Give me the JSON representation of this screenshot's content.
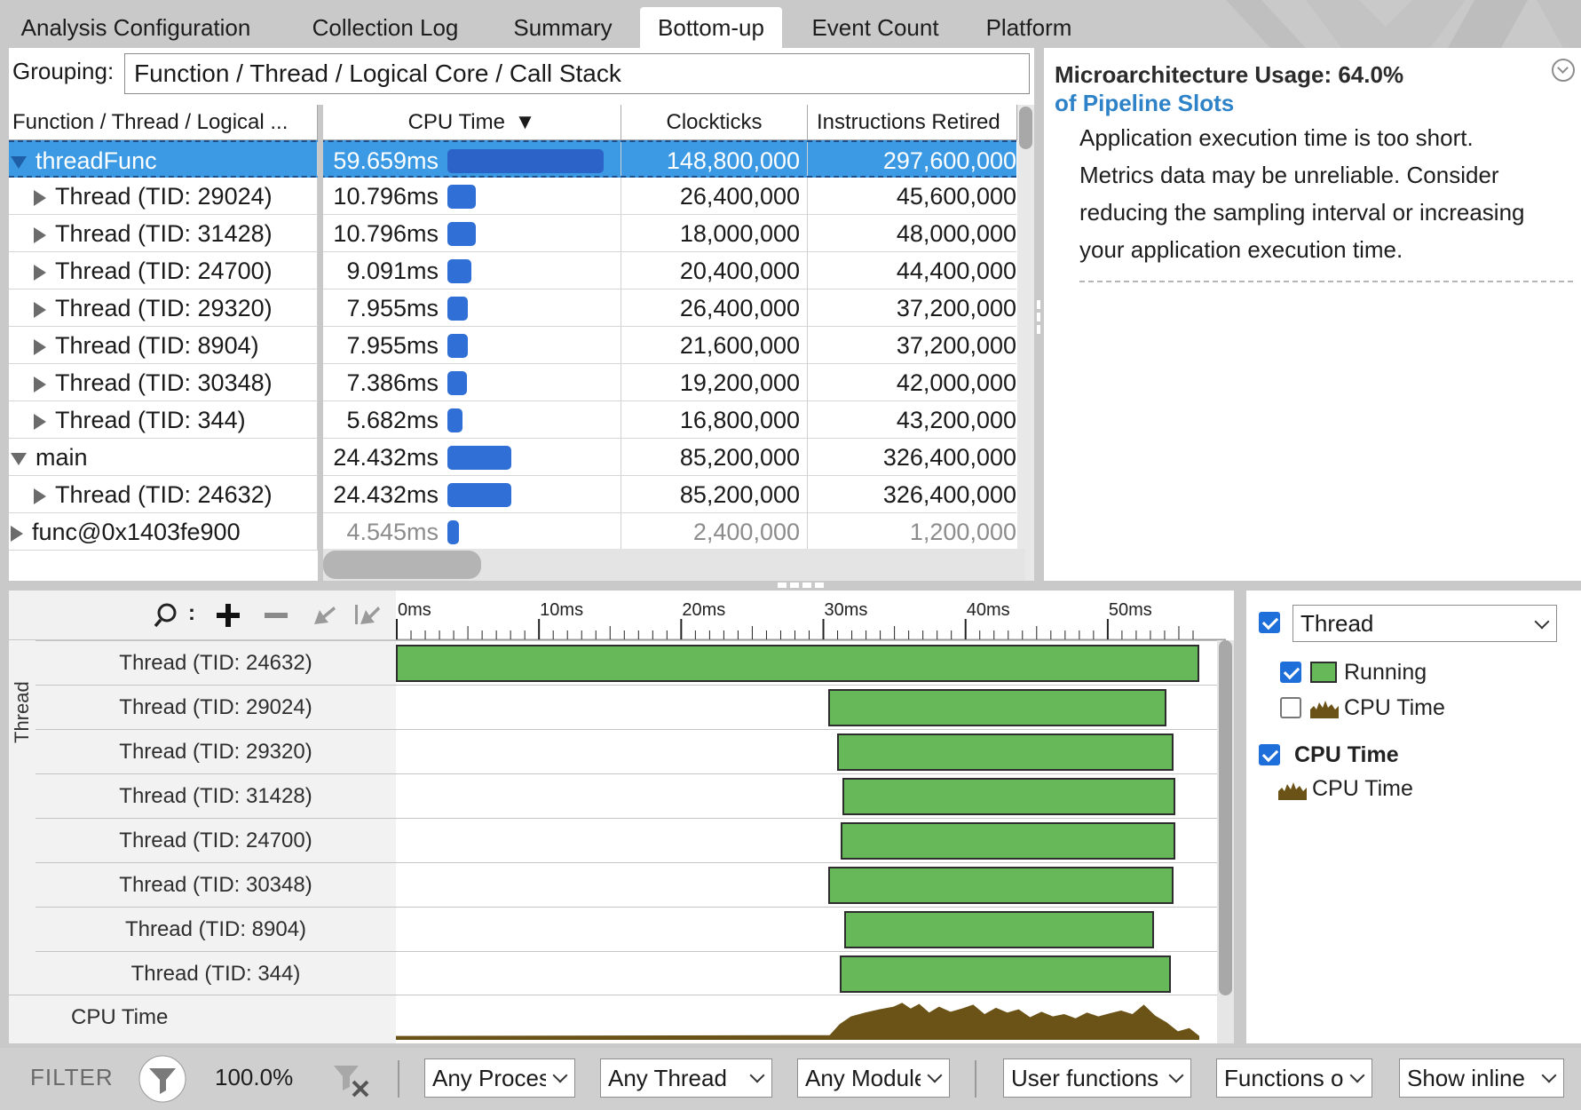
{
  "tabs": [
    {
      "label": "Analysis Configuration",
      "active": false
    },
    {
      "label": "Collection Log",
      "active": false
    },
    {
      "label": "Summary",
      "active": false
    },
    {
      "label": "Bottom-up",
      "active": true
    },
    {
      "label": "Event Count",
      "active": false
    },
    {
      "label": "Platform",
      "active": false
    }
  ],
  "grouping": {
    "label": "Grouping:",
    "value": "Function / Thread / Logical Core / Call Stack"
  },
  "grid": {
    "columns": {
      "name": "Function / Thread / Logical ...",
      "cpu": "CPU Time",
      "sort_indicator": "▼",
      "clockticks": "Clockticks",
      "instructions": "Instructions Retired"
    },
    "rows": [
      {
        "name": "threadFunc",
        "level": 0,
        "expand": "down",
        "cpu": "59.659ms",
        "cpu_fraction": 1.0,
        "clockticks": "148,800,000",
        "instructions": "297,600,000",
        "selected": true,
        "dim": false
      },
      {
        "name": "Thread (TID: 29024)",
        "level": 1,
        "expand": "right",
        "cpu": "10.796ms",
        "cpu_fraction": 0.181,
        "clockticks": "26,400,000",
        "instructions": "45,600,000",
        "selected": false,
        "dim": false
      },
      {
        "name": "Thread (TID: 31428)",
        "level": 1,
        "expand": "right",
        "cpu": "10.796ms",
        "cpu_fraction": 0.181,
        "clockticks": "18,000,000",
        "instructions": "48,000,000",
        "selected": false,
        "dim": false
      },
      {
        "name": "Thread (TID: 24700)",
        "level": 1,
        "expand": "right",
        "cpu": "9.091ms",
        "cpu_fraction": 0.152,
        "clockticks": "20,400,000",
        "instructions": "44,400,000",
        "selected": false,
        "dim": false
      },
      {
        "name": "Thread (TID: 29320)",
        "level": 1,
        "expand": "right",
        "cpu": "7.955ms",
        "cpu_fraction": 0.133,
        "clockticks": "26,400,000",
        "instructions": "37,200,000",
        "selected": false,
        "dim": false
      },
      {
        "name": "Thread (TID: 8904)",
        "level": 1,
        "expand": "right",
        "cpu": "7.955ms",
        "cpu_fraction": 0.133,
        "clockticks": "21,600,000",
        "instructions": "37,200,000",
        "selected": false,
        "dim": false
      },
      {
        "name": "Thread (TID: 30348)",
        "level": 1,
        "expand": "right",
        "cpu": "7.386ms",
        "cpu_fraction": 0.124,
        "clockticks": "19,200,000",
        "instructions": "42,000,000",
        "selected": false,
        "dim": false
      },
      {
        "name": "Thread (TID: 344)",
        "level": 1,
        "expand": "right",
        "cpu": "5.682ms",
        "cpu_fraction": 0.095,
        "clockticks": "16,800,000",
        "instructions": "43,200,000",
        "selected": false,
        "dim": false
      },
      {
        "name": "main",
        "level": 0,
        "expand": "down",
        "cpu": "24.432ms",
        "cpu_fraction": 0.41,
        "clockticks": "85,200,000",
        "instructions": "326,400,000",
        "selected": false,
        "dim": false
      },
      {
        "name": "Thread (TID: 24632)",
        "level": 1,
        "expand": "right",
        "cpu": "24.432ms",
        "cpu_fraction": 0.41,
        "clockticks": "85,200,000",
        "instructions": "326,400,000",
        "selected": false,
        "dim": false
      },
      {
        "name": "func@0x1403fe900",
        "level": 0,
        "expand": "right",
        "cpu": "4.545ms",
        "cpu_fraction": 0.076,
        "clockticks": "2,400,000",
        "instructions": "1,200,000",
        "selected": false,
        "dim": true
      }
    ]
  },
  "info": {
    "title": "Microarchitecture Usage:",
    "value": "64.0%",
    "subtitle": "of Pipeline Slots",
    "body": [
      "Application execution time is too short.",
      "Metrics data may be unreliable. Consider",
      "reducing the sampling interval or increasing",
      "your application execution time."
    ]
  },
  "timeline": {
    "axis_label": "Thread",
    "axis_max_ms": 56.5,
    "ticks": [
      {
        "label": "0ms",
        "ms": 0
      },
      {
        "label": "10ms",
        "ms": 10
      },
      {
        "label": "20ms",
        "ms": 20
      },
      {
        "label": "30ms",
        "ms": 30
      },
      {
        "label": "40ms",
        "ms": 40
      },
      {
        "label": "50ms",
        "ms": 50
      }
    ],
    "threads": [
      {
        "name": "Thread (TID: 24632)",
        "start_ms": 0.0,
        "end_ms": 56.5
      },
      {
        "name": "Thread (TID: 29024)",
        "start_ms": 30.4,
        "end_ms": 54.2
      },
      {
        "name": "Thread (TID: 29320)",
        "start_ms": 31.0,
        "end_ms": 54.7
      },
      {
        "name": "Thread (TID: 31428)",
        "start_ms": 31.4,
        "end_ms": 54.8
      },
      {
        "name": "Thread (TID: 24700)",
        "start_ms": 31.3,
        "end_ms": 54.8
      },
      {
        "name": "Thread (TID: 30348)",
        "start_ms": 30.4,
        "end_ms": 54.7
      },
      {
        "name": "Thread (TID: 8904)",
        "start_ms": 31.5,
        "end_ms": 53.3
      },
      {
        "name": "Thread (TID: 344)",
        "start_ms": 31.2,
        "end_ms": 54.5
      }
    ],
    "cpu_row_label": "CPU Time",
    "cpu_series": [
      {
        "ms": 0,
        "v": 0.1
      },
      {
        "ms": 30.5,
        "v": 0.12
      },
      {
        "ms": 31.2,
        "v": 0.4
      },
      {
        "ms": 32.0,
        "v": 0.6
      },
      {
        "ms": 33.0,
        "v": 0.7
      },
      {
        "ms": 34.0,
        "v": 0.78
      },
      {
        "ms": 35.0,
        "v": 0.85
      },
      {
        "ms": 35.6,
        "v": 0.95
      },
      {
        "ms": 36.2,
        "v": 0.8
      },
      {
        "ms": 36.8,
        "v": 0.92
      },
      {
        "ms": 37.5,
        "v": 0.7
      },
      {
        "ms": 38.2,
        "v": 0.85
      },
      {
        "ms": 39.0,
        "v": 0.72
      },
      {
        "ms": 39.8,
        "v": 0.8
      },
      {
        "ms": 40.6,
        "v": 0.9
      },
      {
        "ms": 41.4,
        "v": 0.66
      },
      {
        "ms": 42.2,
        "v": 0.82
      },
      {
        "ms": 43.0,
        "v": 0.7
      },
      {
        "ms": 43.8,
        "v": 0.78
      },
      {
        "ms": 44.6,
        "v": 0.58
      },
      {
        "ms": 45.4,
        "v": 0.72
      },
      {
        "ms": 46.2,
        "v": 0.6
      },
      {
        "ms": 47.0,
        "v": 0.66
      },
      {
        "ms": 47.8,
        "v": 0.55
      },
      {
        "ms": 48.6,
        "v": 0.7
      },
      {
        "ms": 49.4,
        "v": 0.6
      },
      {
        "ms": 50.2,
        "v": 0.68
      },
      {
        "ms": 51.0,
        "v": 0.75
      },
      {
        "ms": 51.8,
        "v": 0.66
      },
      {
        "ms": 52.6,
        "v": 0.9
      },
      {
        "ms": 53.4,
        "v": 0.62
      },
      {
        "ms": 54.2,
        "v": 0.45
      },
      {
        "ms": 55.0,
        "v": 0.22
      },
      {
        "ms": 55.8,
        "v": 0.3
      },
      {
        "ms": 56.5,
        "v": 0.1
      }
    ]
  },
  "legend": {
    "group_select": "Thread",
    "items": [
      {
        "label": "Running",
        "checked": true
      },
      {
        "label": "CPU Time",
        "checked": false
      }
    ],
    "cpu_group": "CPU Time",
    "cpu_item": "CPU Time"
  },
  "filterbar": {
    "label": "FILTER",
    "percent": "100.0%",
    "selects": [
      "Any Process",
      "Any Thread",
      "Any Module",
      "User functions",
      "Functions only",
      "Show inline"
    ]
  },
  "colors": {
    "selection": "#3b9ae3",
    "cpu_bar": "#2f6fd6",
    "running": "#66b858",
    "cpu_time": "#6b5216",
    "link": "#2d82c8",
    "checkbox": "#1e6fd9"
  }
}
